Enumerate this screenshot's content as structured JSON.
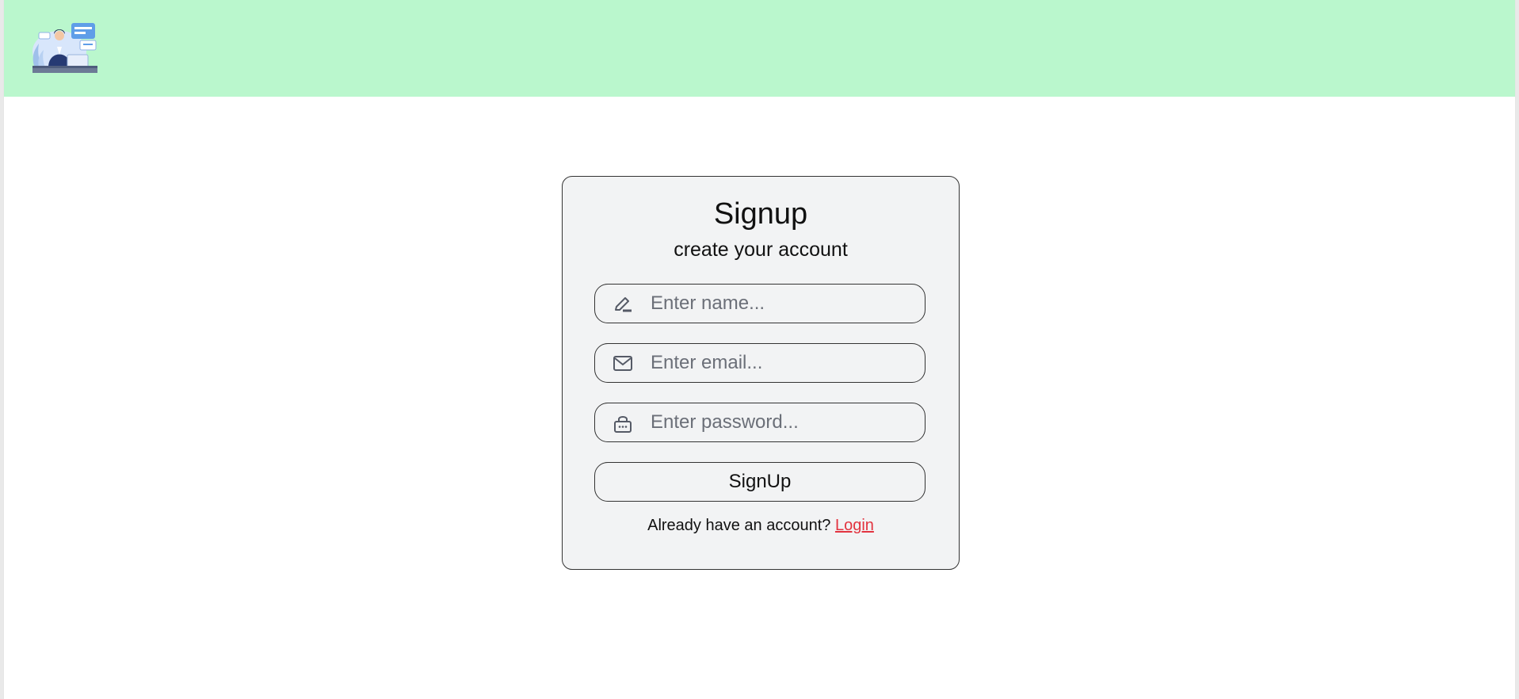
{
  "header": {
    "logo_alt": "support agent illustration",
    "background": "#baf7cd"
  },
  "signup": {
    "title": "Signup",
    "subtitle": "create your account",
    "fields": {
      "name": {
        "placeholder": "Enter name...",
        "value": "",
        "icon": "pen-icon"
      },
      "email": {
        "placeholder": "Enter email...",
        "value": "",
        "icon": "envelope-icon"
      },
      "password": {
        "placeholder": "Enter password...",
        "value": "",
        "icon": "lock-icon"
      }
    },
    "submit_label": "SignUp",
    "login_prompt": "Already have an account?",
    "login_link": "Login",
    "link_color": "#e2333f"
  }
}
